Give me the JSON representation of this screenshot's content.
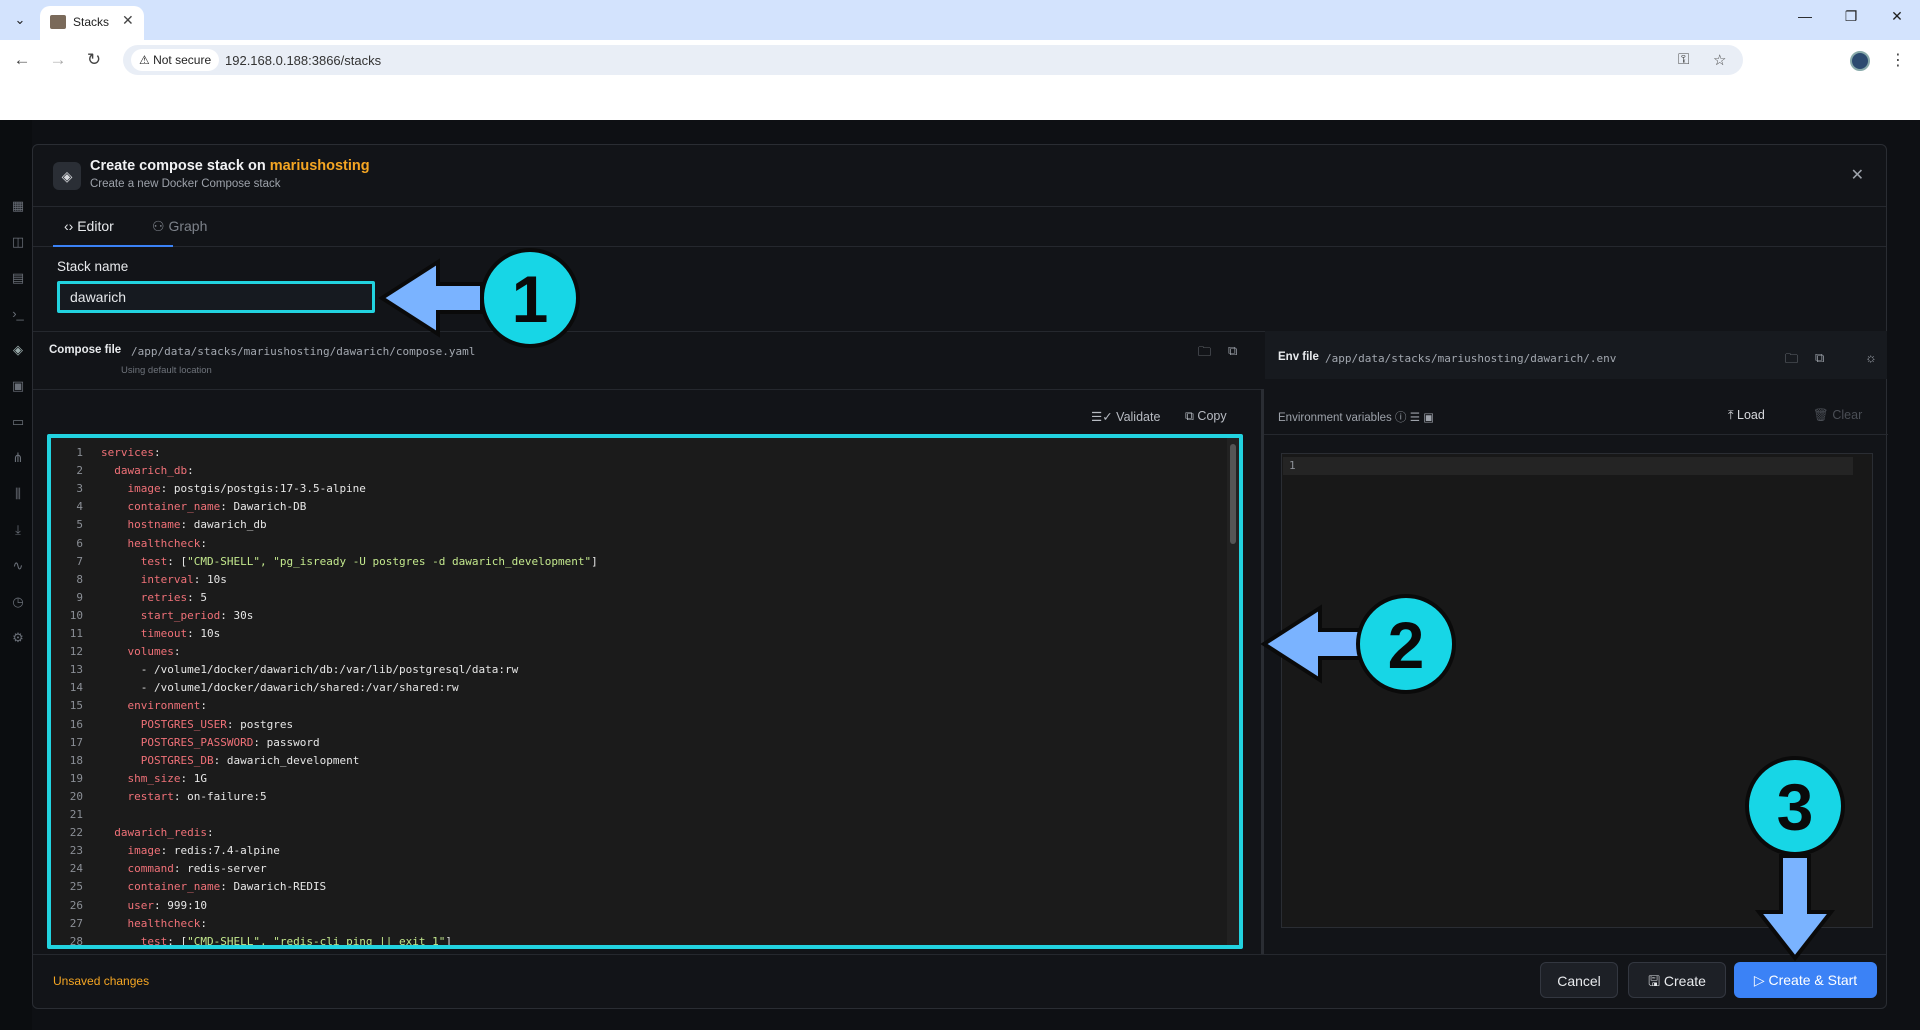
{
  "browser": {
    "tab_title": "Stacks",
    "security_label": "Not secure",
    "url": "192.168.0.188:3866/stacks"
  },
  "modal": {
    "title_prefix": "Create compose stack on",
    "host": "mariushosting",
    "subtitle": "Create a new Docker Compose stack",
    "tabs": [
      "Editor",
      "Graph"
    ],
    "stack_name_label": "Stack name",
    "stack_name_value": "dawarich",
    "compose_file_label": "Compose file",
    "compose_file_path": "/app/data/stacks/mariushosting/dawarich/compose.yaml",
    "compose_file_note": "Using default location",
    "env_file_label": "Env file",
    "env_file_path": "/app/data/stacks/mariushosting/dawarich/.env",
    "validate_label": "Validate",
    "copy_label": "Copy",
    "env_vars_label": "Environment variables",
    "load_label": "Load",
    "clear_label": "Clear",
    "env_line_number": "1",
    "unsaved_label": "Unsaved changes",
    "cancel_label": "Cancel",
    "create_label": "Create",
    "create_start_label": "Create & Start"
  },
  "code_lines": [
    {
      "n": "1",
      "indent": "",
      "key": "services",
      "sep": ":",
      "val": ""
    },
    {
      "n": "2",
      "indent": "  ",
      "key": "dawarich_db",
      "sep": ":",
      "val": ""
    },
    {
      "n": "3",
      "indent": "    ",
      "key": "image",
      "sep": ": ",
      "val": "postgis/postgis:17-3.5-alpine"
    },
    {
      "n": "4",
      "indent": "    ",
      "key": "container_name",
      "sep": ": ",
      "val": "Dawarich-DB"
    },
    {
      "n": "5",
      "indent": "    ",
      "key": "hostname",
      "sep": ": ",
      "val": "dawarich_db"
    },
    {
      "n": "6",
      "indent": "    ",
      "key": "healthcheck",
      "sep": ":",
      "val": ""
    },
    {
      "n": "7",
      "indent": "      ",
      "key": "test",
      "sep": ": [",
      "str": "\"CMD-SHELL\", \"pg_isready -U postgres -d dawarich_development\"",
      "tail": "]"
    },
    {
      "n": "8",
      "indent": "      ",
      "key": "interval",
      "sep": ": ",
      "val": "10s"
    },
    {
      "n": "9",
      "indent": "      ",
      "key": "retries",
      "sep": ": ",
      "val": "5"
    },
    {
      "n": "10",
      "indent": "      ",
      "key": "start_period",
      "sep": ": ",
      "val": "30s"
    },
    {
      "n": "11",
      "indent": "      ",
      "key": "timeout",
      "sep": ": ",
      "val": "10s"
    },
    {
      "n": "12",
      "indent": "    ",
      "key": "volumes",
      "sep": ":",
      "val": ""
    },
    {
      "n": "13",
      "indent": "      ",
      "key": "",
      "sep": "",
      "val": "- /volume1/docker/dawarich/db:/var/lib/postgresql/data:rw"
    },
    {
      "n": "14",
      "indent": "      ",
      "key": "",
      "sep": "",
      "val": "- /volume1/docker/dawarich/shared:/var/shared:rw"
    },
    {
      "n": "15",
      "indent": "    ",
      "key": "environment",
      "sep": ":",
      "val": ""
    },
    {
      "n": "16",
      "indent": "      ",
      "key": "POSTGRES_USER",
      "sep": ": ",
      "val": "postgres"
    },
    {
      "n": "17",
      "indent": "      ",
      "key": "POSTGRES_PASSWORD",
      "sep": ": ",
      "val": "password"
    },
    {
      "n": "18",
      "indent": "      ",
      "key": "POSTGRES_DB",
      "sep": ": ",
      "val": "dawarich_development"
    },
    {
      "n": "19",
      "indent": "    ",
      "key": "shm_size",
      "sep": ": ",
      "val": "1G"
    },
    {
      "n": "20",
      "indent": "    ",
      "key": "restart",
      "sep": ": ",
      "val": "on-failure:5"
    },
    {
      "n": "21",
      "indent": "",
      "key": "",
      "sep": "",
      "val": ""
    },
    {
      "n": "22",
      "indent": "  ",
      "key": "dawarich_redis",
      "sep": ":",
      "val": ""
    },
    {
      "n": "23",
      "indent": "    ",
      "key": "image",
      "sep": ": ",
      "val": "redis:7.4-alpine"
    },
    {
      "n": "24",
      "indent": "    ",
      "key": "command",
      "sep": ": ",
      "val": "redis-server"
    },
    {
      "n": "25",
      "indent": "    ",
      "key": "container_name",
      "sep": ": ",
      "val": "Dawarich-REDIS"
    },
    {
      "n": "26",
      "indent": "    ",
      "key": "user",
      "sep": ": ",
      "val": "999:10"
    },
    {
      "n": "27",
      "indent": "    ",
      "key": "healthcheck",
      "sep": ":",
      "val": ""
    },
    {
      "n": "28",
      "indent": "      ",
      "key": "test",
      "sep": ": [",
      "str": "\"CMD-SHELL\", \"redis-cli ping || exit 1\"",
      "tail": "]"
    }
  ],
  "annotations": [
    "1",
    "2",
    "3"
  ]
}
